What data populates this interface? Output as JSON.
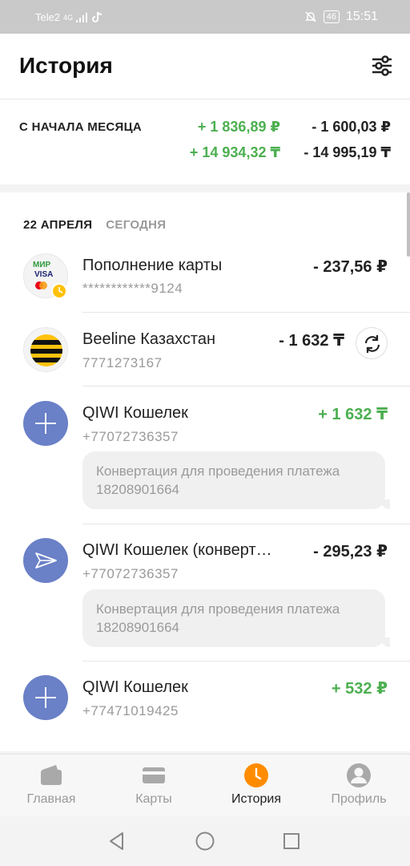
{
  "status_bar": {
    "carrier": "Tele2",
    "network": "4G",
    "battery": "46",
    "time": "15:51"
  },
  "header": {
    "title": "История"
  },
  "summary": {
    "label": "С НАЧАЛА МЕСЯЦА",
    "income_rub": "+ 1 836,89 ₽",
    "expense_rub": "- 1 600,03 ₽",
    "income_kzt": "+ 14 934,32 ₸",
    "expense_kzt": "- 14 995,19 ₸"
  },
  "date_header": {
    "date": "22 АПРЕЛЯ",
    "relative": "СЕГОДНЯ"
  },
  "transactions": [
    {
      "icon": "payment-cards-icon",
      "name": "Пополнение карты",
      "sub": "************9124",
      "amount": "- 237,56 ₽",
      "amount_type": "expense"
    },
    {
      "icon": "beeline-logo-icon",
      "name": "Beeline Казахстан",
      "sub": "7771273167",
      "amount": "- 1 632 ₸",
      "amount_type": "expense",
      "has_repeat": true
    },
    {
      "icon": "plus-icon",
      "name": "QIWI Кошелек",
      "sub": "+77072736357",
      "amount": "+ 1 632 ₸",
      "amount_type": "income",
      "comment": "Конвертация для проведения платежа 18208901664"
    },
    {
      "icon": "send-icon",
      "name": "QIWI Кошелек (конверт…",
      "sub": "+77072736357",
      "amount": "- 295,23 ₽",
      "amount_type": "expense",
      "comment": "Конвертация для проведения платежа 18208901664"
    },
    {
      "icon": "plus-icon",
      "name": "QIWI Кошелек",
      "sub": "+77471019425",
      "amount": "+ 532 ₽",
      "amount_type": "income"
    }
  ],
  "bottom_nav": {
    "items": [
      {
        "label": "Главная",
        "icon": "wallet-icon"
      },
      {
        "label": "Карты",
        "icon": "card-icon"
      },
      {
        "label": "История",
        "icon": "clock-icon",
        "active": true
      },
      {
        "label": "Профиль",
        "icon": "profile-icon"
      }
    ]
  },
  "colors": {
    "income": "#4caf50",
    "accent": "#ff8c00",
    "avatar_blue": "#6a80c7"
  }
}
